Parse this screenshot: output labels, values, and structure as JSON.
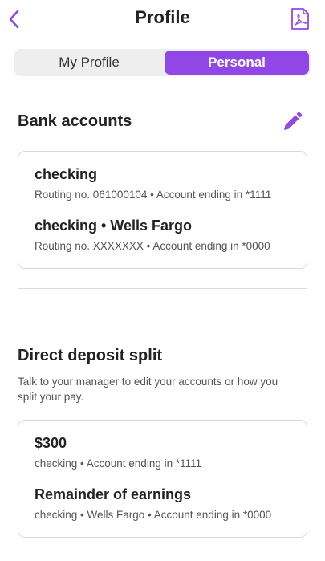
{
  "header": {
    "title": "Profile",
    "back_icon": "chevron-left-icon",
    "pdf_icon": "pdf-file-icon"
  },
  "tabs": [
    {
      "label": "My Profile",
      "selected": false
    },
    {
      "label": "Personal",
      "selected": true
    }
  ],
  "bank_accounts": {
    "heading": "Bank accounts",
    "edit_icon": "pencil-icon",
    "items": [
      {
        "title": "checking",
        "detail": "Routing no. 061000104 • Account ending in *1111"
      },
      {
        "title": "checking • Wells Fargo",
        "detail": "Routing no. XXXXXXX • Account ending in *0000"
      }
    ]
  },
  "direct_deposit": {
    "heading": "Direct deposit split",
    "description": "Talk to your manager to edit your accounts or how you split your pay.",
    "items": [
      {
        "title": "$300",
        "detail": "checking • Account ending in *1111"
      },
      {
        "title": "Remainder of earnings",
        "detail": "checking • Wells Fargo • Account ending in *0000"
      }
    ]
  },
  "colors": {
    "accent": "#9146e6",
    "border": "#d9d9d9",
    "muted_text": "#555555"
  }
}
